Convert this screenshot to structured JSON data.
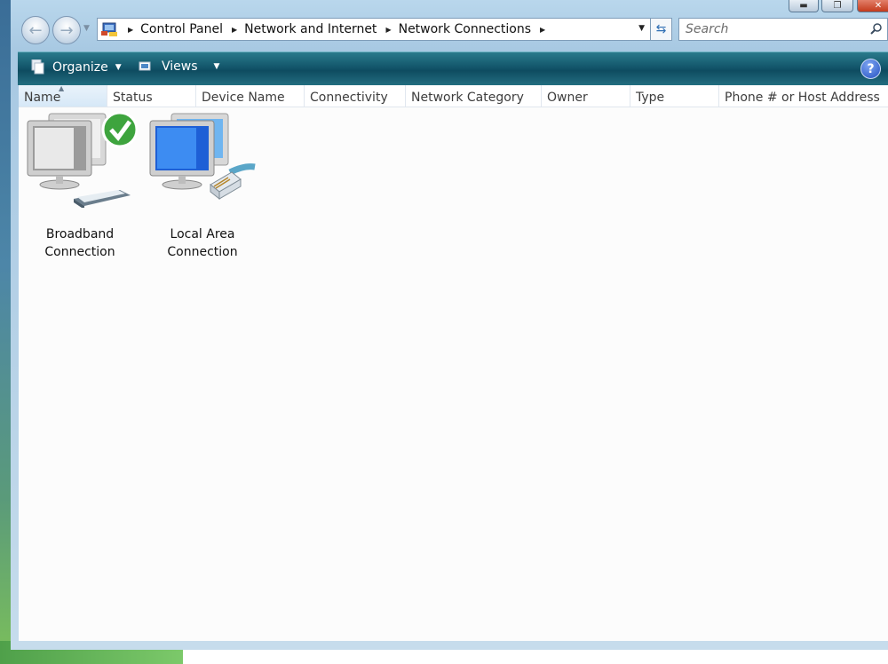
{
  "nav": {
    "back_label": "Back",
    "forward_label": "Forward"
  },
  "address": {
    "crumbs": [
      "Control Panel",
      "Network and Internet",
      "Network Connections"
    ]
  },
  "search": {
    "placeholder": "Search"
  },
  "toolbar": {
    "organize_label": "Organize",
    "views_label": "Views",
    "help_label": "?"
  },
  "columns": [
    "Name",
    "Status",
    "Device Name",
    "Connectivity",
    "Network Category",
    "Owner",
    "Type",
    "Phone # or Host Address"
  ],
  "sorted_column": "Name",
  "items": [
    {
      "label": "Broadband Connection",
      "icon": "broadband-connection-icon",
      "status": "connected"
    },
    {
      "label": "Local Area Connection",
      "icon": "local-area-connection-icon"
    }
  ],
  "colors": {
    "command_bar": "#13566b",
    "window_frame": "#b9d7ec",
    "content_bg": "#fcfcfc",
    "close_button": "#c33a1c"
  }
}
